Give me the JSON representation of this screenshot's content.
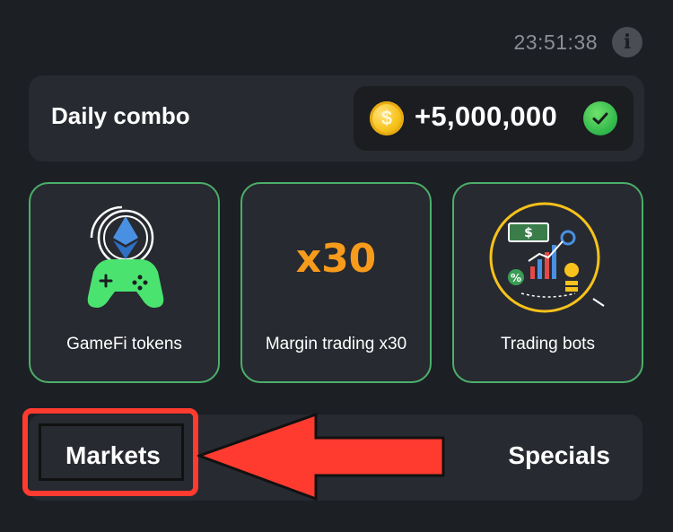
{
  "status": {
    "time": "23:51:38",
    "info_icon": "info-icon"
  },
  "daily_combo": {
    "title": "Daily combo",
    "coin_icon": "coin-icon",
    "reward": "+5,000,000",
    "status_icon": "check-circle-icon"
  },
  "cards": [
    {
      "label": "GameFi tokens",
      "icon": "gamepad-ethereum-icon"
    },
    {
      "label": "Margin trading x30",
      "icon_text": "x30"
    },
    {
      "label": "Trading bots",
      "icon": "trading-bots-icon"
    }
  ],
  "tabs": [
    {
      "label": "Markets"
    },
    {
      "label": "Specials"
    }
  ],
  "annotation": {
    "highlight": "Markets",
    "arrow": "red-arrow-pointing-left",
    "color": "#ff3b30"
  },
  "colors": {
    "background": "#1c1f24",
    "card": "#272a30",
    "accent_green": "#4caf6a",
    "accent_orange": "#f79b1c"
  }
}
